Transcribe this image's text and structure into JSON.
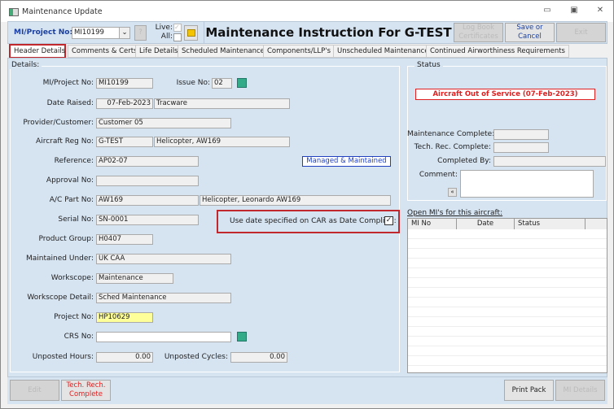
{
  "window": {
    "title": "Maintenance Update"
  },
  "toolbar": {
    "mi_label": "MI/Project No:",
    "mi_value": "MI10199",
    "help": "?",
    "live_label": "Live:",
    "all_label": "All:",
    "heading": "Maintenance Instruction For G-TEST",
    "logbook": "Log Book Certificates",
    "save": "Save or Cancel",
    "exit": "Exit"
  },
  "tabs": [
    "Header Details",
    "Comments & Certs",
    "Life Details",
    "Scheduled Maintenance",
    "Components/LLP's",
    "Unscheduled Maintenance",
    "Continued Airworthiness Requirements"
  ],
  "details": {
    "title": "Details:",
    "mi_label": "MI/Project No:",
    "mi": "MI10199",
    "issue_label": "Issue No:",
    "issue": "02",
    "date_label": "Date Raised:",
    "date": "07-Feb-2023",
    "date_by": "Tracware",
    "provider_label": "Provider/Customer:",
    "provider": "Customer 05",
    "reg_label": "Aircraft Reg No:",
    "reg": "G-TEST",
    "reg_type": "Helicopter, AW169",
    "ref_label": "Reference:",
    "ref": "AP02-07",
    "managed": "Managed & Maintained",
    "approval_label": "Approval No:",
    "approval": "",
    "part_label": "A/C Part No:",
    "part": "AW169",
    "part_desc": "Helicopter, Leonardo AW169",
    "serial_label": "Serial No:",
    "serial": "SN-0001",
    "car_label": "Use date specified on CAR as Date Complied:",
    "car_checked": true,
    "pg_label": "Product Group:",
    "pg": "H0407",
    "mu_label": "Maintained Under:",
    "mu": "UK CAA",
    "ws_label": "Workscope:",
    "ws": "Maintenance",
    "wsd_label": "Workscope Detail:",
    "wsd": "Sched Maintenance",
    "proj_label": "Project No:",
    "proj": "HP10629",
    "crs_label": "CRS No:",
    "crs": "",
    "hours_label": "Unposted Hours:",
    "hours": "0.00",
    "cycles_label": "Unposted Cycles:",
    "cycles": "0.00"
  },
  "status": {
    "title": "Status",
    "banner": "Aircraft Out of Service (07-Feb-2023)",
    "mc_label": "Maintenance Complete:",
    "trc_label": "Tech. Rec. Complete:",
    "cb_label": "Completed By:",
    "comment_label": "Comment:",
    "comment": "",
    "open_label": "Open MI's for this aircraft:",
    "columns": [
      "MI No",
      "Date",
      "Status"
    ]
  },
  "bottom": {
    "edit": "Edit",
    "tech": "Tech. Rech. Complete",
    "print": "Print Pack",
    "mi_details": "MI Details"
  }
}
